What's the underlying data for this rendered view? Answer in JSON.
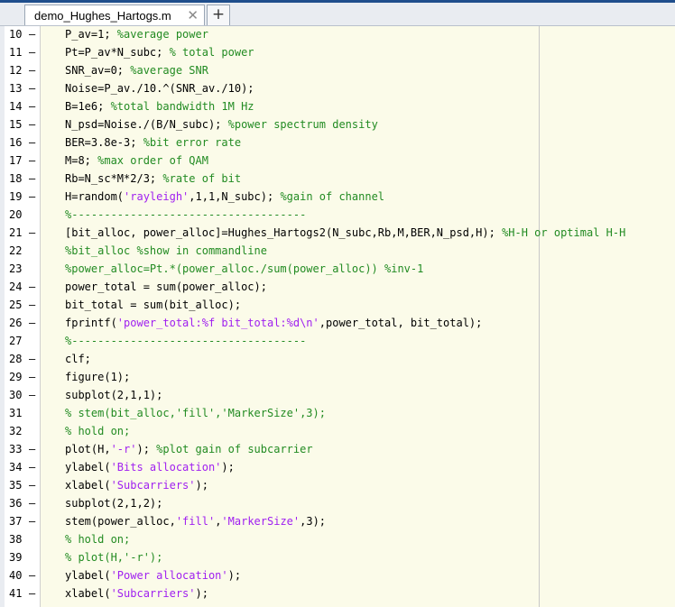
{
  "tab": {
    "filename": "demo_Hughes_Hartogs.m",
    "close_glyph": "✕",
    "new_glyph": "+"
  },
  "colors": {
    "comment": "#228b22",
    "string": "#a020f0",
    "code_bg": "#fbfbe9"
  },
  "lines": [
    {
      "n": "10",
      "d": "–",
      "segs": [
        {
          "t": "P_av=1; ",
          "k": "p"
        },
        {
          "t": "%average power",
          "k": "c"
        }
      ]
    },
    {
      "n": "11",
      "d": "–",
      "segs": [
        {
          "t": "Pt=P_av*N_subc; ",
          "k": "p"
        },
        {
          "t": "% total power",
          "k": "c"
        }
      ]
    },
    {
      "n": "12",
      "d": "–",
      "segs": [
        {
          "t": "SNR_av=0; ",
          "k": "p"
        },
        {
          "t": "%average SNR",
          "k": "c"
        }
      ]
    },
    {
      "n": "13",
      "d": "–",
      "segs": [
        {
          "t": "Noise=P_av./10.^(SNR_av./10);",
          "k": "p"
        }
      ]
    },
    {
      "n": "14",
      "d": "–",
      "segs": [
        {
          "t": "B=1e6; ",
          "k": "p"
        },
        {
          "t": "%total bandwidth 1M Hz",
          "k": "c"
        }
      ]
    },
    {
      "n": "15",
      "d": "–",
      "segs": [
        {
          "t": "N_psd=Noise./(B/N_subc); ",
          "k": "p"
        },
        {
          "t": "%power spectrum density",
          "k": "c"
        }
      ]
    },
    {
      "n": "16",
      "d": "–",
      "segs": [
        {
          "t": "BER=3.8e-3; ",
          "k": "p"
        },
        {
          "t": "%bit error rate",
          "k": "c"
        }
      ]
    },
    {
      "n": "17",
      "d": "–",
      "segs": [
        {
          "t": "M=8; ",
          "k": "p"
        },
        {
          "t": "%max order of QAM",
          "k": "c"
        }
      ]
    },
    {
      "n": "18",
      "d": "–",
      "segs": [
        {
          "t": "Rb=N_sc*M*2/3; ",
          "k": "p"
        },
        {
          "t": "%rate of bit",
          "k": "c"
        }
      ]
    },
    {
      "n": "19",
      "d": "–",
      "segs": [
        {
          "t": "H=random(",
          "k": "p"
        },
        {
          "t": "'rayleigh'",
          "k": "s"
        },
        {
          "t": ",1,1,N_subc); ",
          "k": "p"
        },
        {
          "t": "%gain of channel",
          "k": "c"
        }
      ]
    },
    {
      "n": "20",
      "d": "",
      "segs": [
        {
          "t": "%------------------------------------",
          "k": "c"
        }
      ]
    },
    {
      "n": "21",
      "d": "–",
      "segs": [
        {
          "t": "[bit_alloc, power_alloc]=Hughes_Hartogs2(N_subc,Rb,M,BER,N_psd,H); ",
          "k": "p"
        },
        {
          "t": "%H-H or optimal H-H",
          "k": "c"
        }
      ]
    },
    {
      "n": "22",
      "d": "",
      "segs": [
        {
          "t": "%bit_alloc %show in commandline",
          "k": "c"
        }
      ]
    },
    {
      "n": "23",
      "d": "",
      "segs": [
        {
          "t": "%power_alloc=Pt.*(power_alloc./sum(power_alloc)) %inv-1",
          "k": "c"
        }
      ]
    },
    {
      "n": "24",
      "d": "–",
      "segs": [
        {
          "t": "power_total = sum(power_alloc);",
          "k": "p"
        }
      ]
    },
    {
      "n": "25",
      "d": "–",
      "segs": [
        {
          "t": "bit_total = sum(bit_alloc);",
          "k": "p"
        }
      ]
    },
    {
      "n": "26",
      "d": "–",
      "segs": [
        {
          "t": "fprintf(",
          "k": "p"
        },
        {
          "t": "'power_total:%f bit_total:%d\\n'",
          "k": "s"
        },
        {
          "t": ",power_total, bit_total);",
          "k": "p"
        }
      ]
    },
    {
      "n": "27",
      "d": "",
      "segs": [
        {
          "t": "%------------------------------------",
          "k": "c"
        }
      ]
    },
    {
      "n": "28",
      "d": "–",
      "segs": [
        {
          "t": "clf;",
          "k": "p"
        }
      ]
    },
    {
      "n": "29",
      "d": "–",
      "segs": [
        {
          "t": "figure(1);",
          "k": "p"
        }
      ]
    },
    {
      "n": "30",
      "d": "–",
      "segs": [
        {
          "t": "subplot(2,1,1);",
          "k": "p"
        }
      ]
    },
    {
      "n": "31",
      "d": "",
      "segs": [
        {
          "t": "% stem(bit_alloc,'fill','MarkerSize',3);",
          "k": "c"
        }
      ]
    },
    {
      "n": "32",
      "d": "",
      "segs": [
        {
          "t": "% hold on;",
          "k": "c"
        }
      ]
    },
    {
      "n": "33",
      "d": "–",
      "segs": [
        {
          "t": "plot(H,",
          "k": "p"
        },
        {
          "t": "'-r'",
          "k": "s"
        },
        {
          "t": "); ",
          "k": "p"
        },
        {
          "t": "%plot gain of subcarrier",
          "k": "c"
        }
      ]
    },
    {
      "n": "34",
      "d": "–",
      "segs": [
        {
          "t": "ylabel(",
          "k": "p"
        },
        {
          "t": "'Bits allocation'",
          "k": "s"
        },
        {
          "t": ");",
          "k": "p"
        }
      ]
    },
    {
      "n": "35",
      "d": "–",
      "segs": [
        {
          "t": "xlabel(",
          "k": "p"
        },
        {
          "t": "'Subcarriers'",
          "k": "s"
        },
        {
          "t": ");",
          "k": "p"
        }
      ]
    },
    {
      "n": "36",
      "d": "–",
      "segs": [
        {
          "t": "subplot(2,1,2);",
          "k": "p"
        }
      ]
    },
    {
      "n": "37",
      "d": "–",
      "segs": [
        {
          "t": "stem(power_alloc,",
          "k": "p"
        },
        {
          "t": "'fill'",
          "k": "s"
        },
        {
          "t": ",",
          "k": "p"
        },
        {
          "t": "'MarkerSize'",
          "k": "s"
        },
        {
          "t": ",3);",
          "k": "p"
        }
      ]
    },
    {
      "n": "38",
      "d": "",
      "segs": [
        {
          "t": "% hold on;",
          "k": "c"
        }
      ]
    },
    {
      "n": "39",
      "d": "",
      "segs": [
        {
          "t": "% plot(H,'-r');",
          "k": "c"
        }
      ]
    },
    {
      "n": "40",
      "d": "–",
      "segs": [
        {
          "t": "ylabel(",
          "k": "p"
        },
        {
          "t": "'Power allocation'",
          "k": "s"
        },
        {
          "t": ");",
          "k": "p"
        }
      ]
    },
    {
      "n": "41",
      "d": "–",
      "segs": [
        {
          "t": "xlabel(",
          "k": "p"
        },
        {
          "t": "'Subcarriers'",
          "k": "s"
        },
        {
          "t": ");",
          "k": "p"
        }
      ]
    }
  ]
}
